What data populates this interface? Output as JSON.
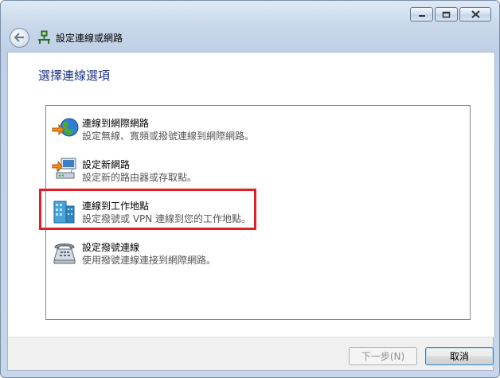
{
  "window": {
    "title": "設定連線或網路",
    "controls": {
      "minimize_icon": "minimize-icon",
      "maximize_icon": "maximize-icon",
      "close_icon": "close-icon"
    }
  },
  "page": {
    "heading": "選擇連線選項"
  },
  "options": [
    {
      "icon": "globe-connect-icon",
      "title": "連線到網際網路",
      "description": "設定無線、寬頻或撥號連線到網際網路。"
    },
    {
      "icon": "router-icon",
      "title": "設定新網路",
      "description": "設定新的路由器或存取點。"
    },
    {
      "icon": "office-building-icon",
      "title": "連線到工作地點",
      "description": "設定撥號或 VPN 連線到您的工作地點。",
      "highlighted": true
    },
    {
      "icon": "dialup-phone-icon",
      "title": "設定撥號連線",
      "description": "使用撥號連線連接到網際網路。"
    }
  ],
  "buttons": {
    "next": {
      "label": "下一步(N)",
      "enabled": false
    },
    "cancel": {
      "label": "取消",
      "enabled": true
    }
  },
  "colors": {
    "heading": "#1e3287",
    "highlight_border": "#e21f26"
  }
}
